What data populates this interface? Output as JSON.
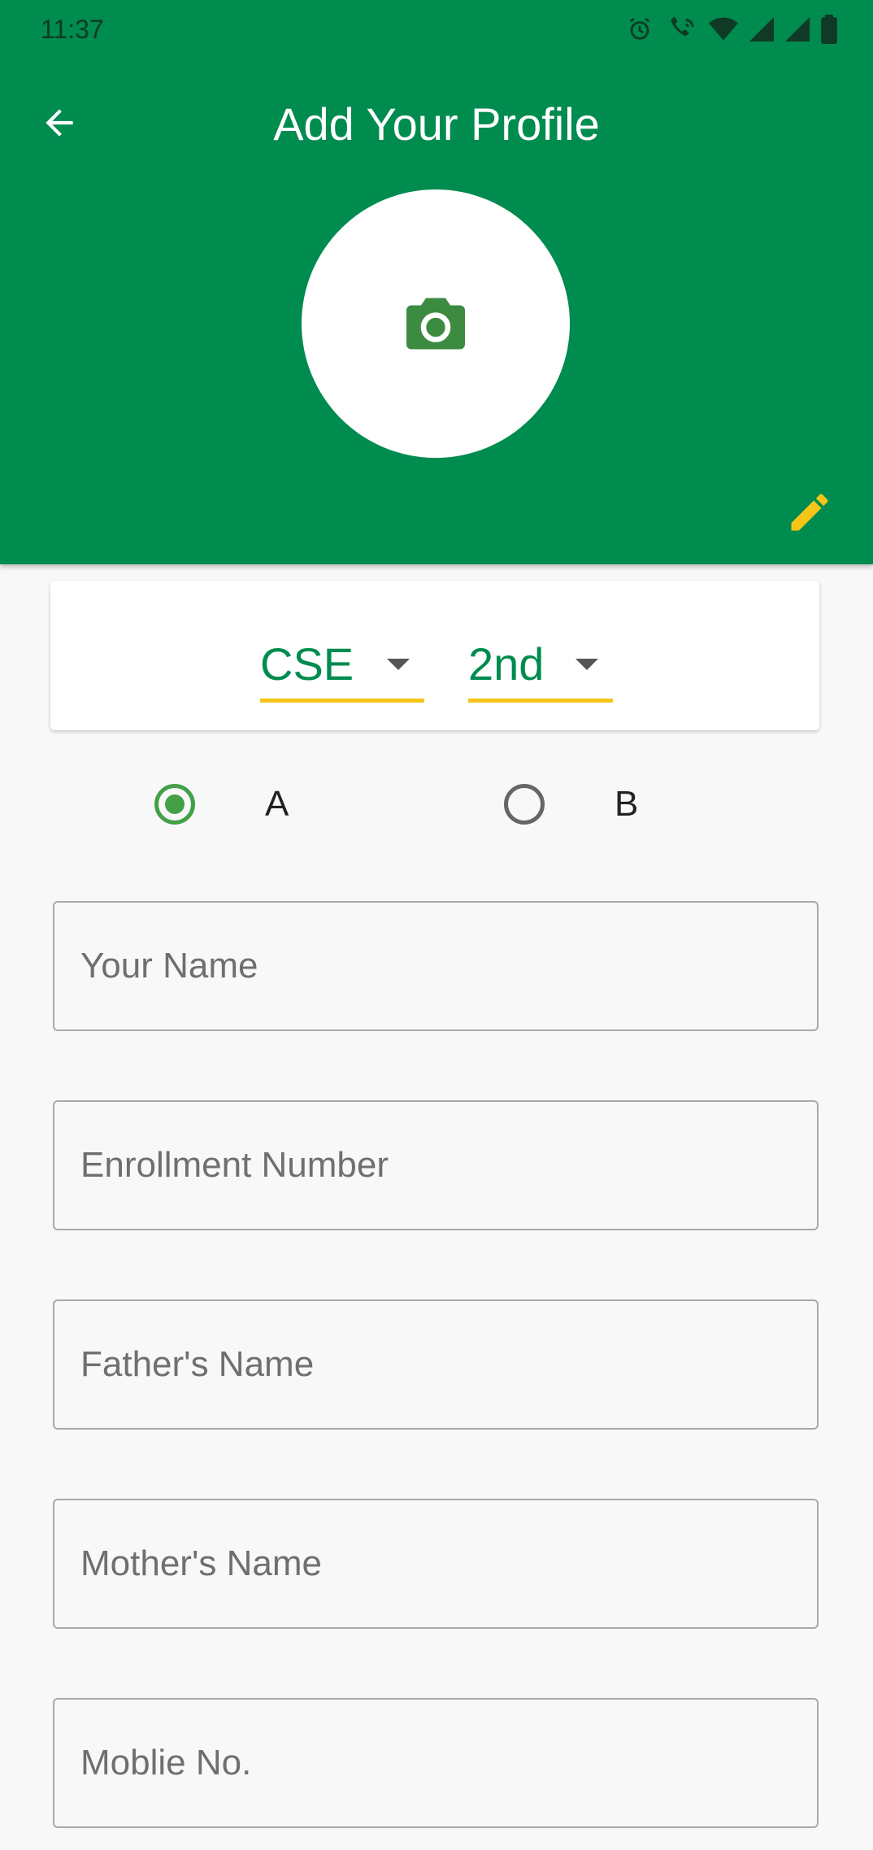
{
  "status_bar": {
    "time": "11:37",
    "icons": [
      "alarm-icon",
      "wifi-calling-icon",
      "wifi-icon",
      "signal-icon",
      "signal-icon",
      "battery-icon"
    ]
  },
  "header": {
    "title": "Add Your Profile",
    "back_icon": "arrow-left-icon",
    "avatar_icon": "camera-icon",
    "edit_icon": "pencil-icon",
    "background_color": "#008b4f"
  },
  "selectors": {
    "branch": {
      "value": "CSE"
    },
    "year": {
      "value": "2nd"
    },
    "accent_color": "#f5c518"
  },
  "section_radio": {
    "options": [
      {
        "label": "A",
        "selected": true
      },
      {
        "label": "B",
        "selected": false
      }
    ],
    "selected_color": "#43a047"
  },
  "form": {
    "name": {
      "value": "",
      "placeholder": "Your Name"
    },
    "enrollment": {
      "value": "",
      "placeholder": "Enrollment Number"
    },
    "father_name": {
      "value": "",
      "placeholder": "Father's Name"
    },
    "mother_name": {
      "value": "",
      "placeholder": "Mother's Name"
    },
    "mobile": {
      "value": "",
      "placeholder": "Moblie No."
    }
  }
}
